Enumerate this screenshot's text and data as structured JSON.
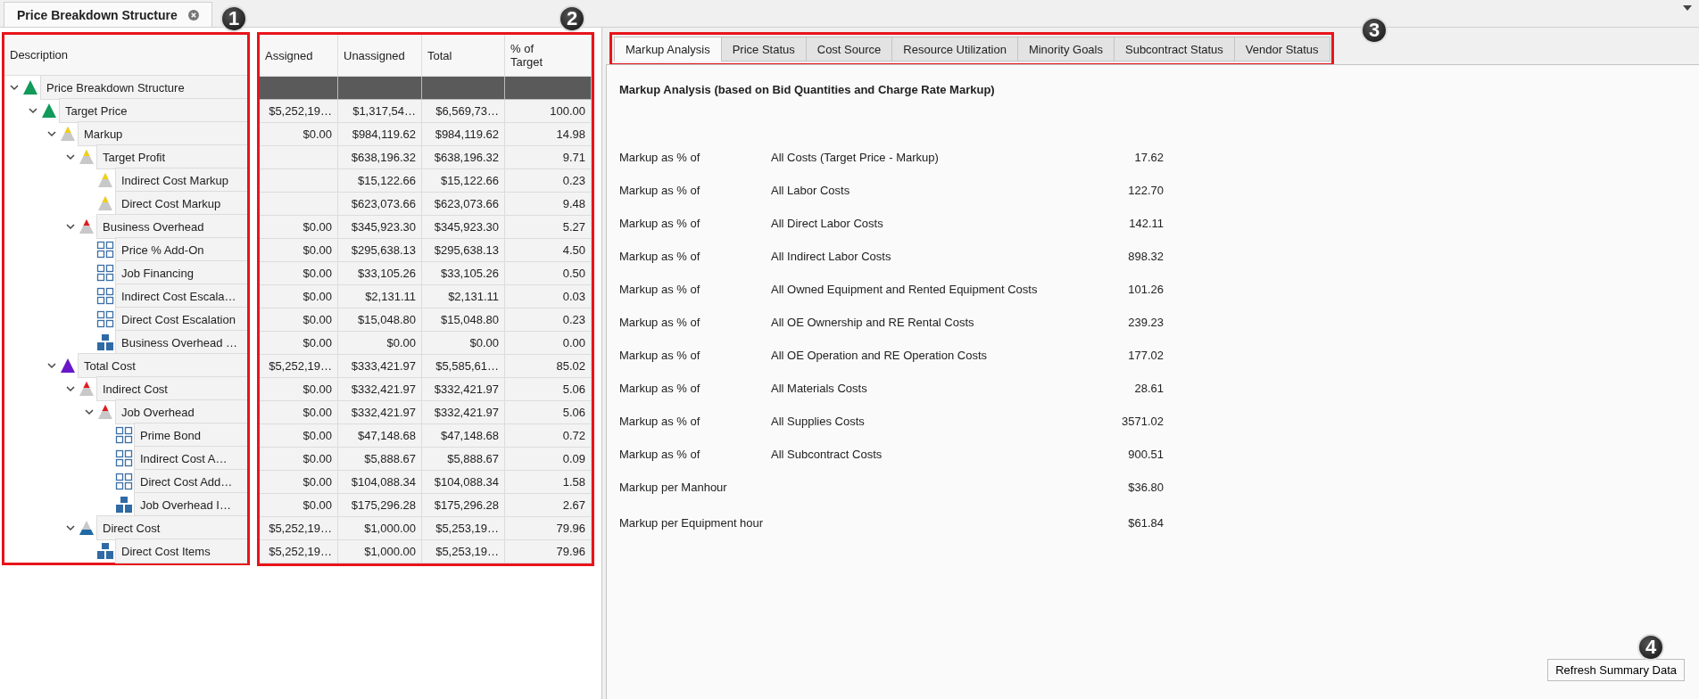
{
  "document_tab": {
    "title": "Price Breakdown Structure"
  },
  "tree": {
    "columns": [
      "Description",
      "Assigned",
      "Unassigned",
      "Total",
      "% of Target"
    ],
    "rows": [
      {
        "label": "Price Breakdown Structure",
        "kind": "target",
        "expanded": true,
        "children": [
          {
            "label": "Target Price",
            "kind": "target",
            "expanded": true,
            "cells": [
              "$5,252,19…",
              "$1,317,54…",
              "$6,569,73…",
              "100.00"
            ],
            "children": [
              {
                "label": "Markup",
                "kind": "markup",
                "expanded": true,
                "cells": [
                  "$0.00",
                  "$984,119.62",
                  "$984,119.62",
                  "14.98"
                ],
                "children": [
                  {
                    "label": "Target Profit",
                    "kind": "markup",
                    "expanded": true,
                    "cells": [
                      "",
                      "$638,196.32",
                      "$638,196.32",
                      "9.71"
                    ],
                    "children": [
                      {
                        "label": "Indirect Cost Markup",
                        "kind": "markup",
                        "cells": [
                          "",
                          "$15,122.66",
                          "$15,122.66",
                          "0.23"
                        ]
                      },
                      {
                        "label": "Direct Cost Markup",
                        "kind": "markup",
                        "cells": [
                          "",
                          "$623,073.66",
                          "$623,073.66",
                          "9.48"
                        ]
                      }
                    ]
                  },
                  {
                    "label": "Business Overhead",
                    "kind": "overhead",
                    "expanded": true,
                    "cells": [
                      "$0.00",
                      "$345,923.30",
                      "$345,923.30",
                      "5.27"
                    ],
                    "children": [
                      {
                        "label": "Price % Add-On",
                        "kind": "addon",
                        "cells": [
                          "$0.00",
                          "$295,638.13",
                          "$295,638.13",
                          "4.50"
                        ]
                      },
                      {
                        "label": "Job Financing",
                        "kind": "addon",
                        "cells": [
                          "$0.00",
                          "$33,105.26",
                          "$33,105.26",
                          "0.50"
                        ]
                      },
                      {
                        "label": "Indirect Cost Escala…",
                        "kind": "addon",
                        "cells": [
                          "$0.00",
                          "$2,131.11",
                          "$2,131.11",
                          "0.03"
                        ]
                      },
                      {
                        "label": "Direct Cost Escalation",
                        "kind": "addon",
                        "cells": [
                          "$0.00",
                          "$15,048.80",
                          "$15,048.80",
                          "0.23"
                        ]
                      },
                      {
                        "label": "Business Overhead …",
                        "kind": "items",
                        "cells": [
                          "$0.00",
                          "$0.00",
                          "$0.00",
                          "0.00"
                        ]
                      }
                    ]
                  }
                ]
              },
              {
                "label": "Total Cost",
                "kind": "total",
                "expanded": true,
                "cells": [
                  "$5,252,19…",
                  "$333,421.97",
                  "$5,585,61…",
                  "85.02"
                ],
                "children": [
                  {
                    "label": "Indirect Cost",
                    "kind": "overhead",
                    "expanded": true,
                    "cells": [
                      "$0.00",
                      "$332,421.97",
                      "$332,421.97",
                      "5.06"
                    ],
                    "children": [
                      {
                        "label": "Job Overhead",
                        "kind": "overhead",
                        "expanded": true,
                        "cells": [
                          "$0.00",
                          "$332,421.97",
                          "$332,421.97",
                          "5.06"
                        ],
                        "children": [
                          {
                            "label": "Prime Bond",
                            "kind": "addon",
                            "cells": [
                              "$0.00",
                              "$47,148.68",
                              "$47,148.68",
                              "0.72"
                            ]
                          },
                          {
                            "label": "Indirect Cost A…",
                            "kind": "addon",
                            "cells": [
                              "$0.00",
                              "$5,888.67",
                              "$5,888.67",
                              "0.09"
                            ]
                          },
                          {
                            "label": "Direct Cost Add…",
                            "kind": "addon",
                            "cells": [
                              "$0.00",
                              "$104,088.34",
                              "$104,088.34",
                              "1.58"
                            ]
                          },
                          {
                            "label": "Job Overhead I…",
                            "kind": "items",
                            "cells": [
                              "$0.00",
                              "$175,296.28",
                              "$175,296.28",
                              "2.67"
                            ]
                          }
                        ]
                      }
                    ]
                  },
                  {
                    "label": "Direct Cost",
                    "kind": "direct",
                    "expanded": true,
                    "cells": [
                      "$5,252,19…",
                      "$1,000.00",
                      "$5,253,19…",
                      "79.96"
                    ],
                    "children": [
                      {
                        "label": "Direct Cost Items",
                        "kind": "items",
                        "cells": [
                          "$5,252,19…",
                          "$1,000.00",
                          "$5,253,19…",
                          "79.96"
                        ]
                      }
                    ]
                  }
                ]
              }
            ]
          }
        ]
      }
    ]
  },
  "summary": {
    "tabs": [
      {
        "label": "Markup Analysis",
        "selected": true
      },
      {
        "label": "Price Status",
        "selected": false
      },
      {
        "label": "Cost Source",
        "selected": false
      },
      {
        "label": "Resource Utilization",
        "selected": false
      },
      {
        "label": "Minority Goals",
        "selected": false
      },
      {
        "label": "Subcontract Status",
        "selected": false
      },
      {
        "label": "Vendor Status",
        "selected": false
      }
    ],
    "heading": "Markup Analysis (based on Bid Quantities and Charge Rate Markup)",
    "rows": [
      {
        "label": "Markup as % of",
        "basis": "All Costs (Target Price - Markup)",
        "value": "17.62"
      },
      {
        "label": "Markup as % of",
        "basis": "All Labor Costs",
        "value": "122.70"
      },
      {
        "label": "Markup as % of",
        "basis": "All Direct Labor Costs",
        "value": "142.11"
      },
      {
        "label": "Markup as % of",
        "basis": "All Indirect Labor Costs",
        "value": "898.32"
      },
      {
        "label": "Markup as % of",
        "basis": "All Owned Equipment and Rented Equipment Costs",
        "value": "101.26"
      },
      {
        "label": "Markup as % of",
        "basis": "All OE Ownership and RE Rental Costs",
        "value": "239.23"
      },
      {
        "label": "Markup as % of",
        "basis": "All OE Operation and RE Operation Costs",
        "value": "177.02"
      },
      {
        "label": "Markup as % of",
        "basis": "All Materials Costs",
        "value": "28.61"
      },
      {
        "label": "Markup as % of",
        "basis": "All Supplies Costs",
        "value": "3571.02"
      },
      {
        "label": "Markup as % of",
        "basis": "All Subcontract Costs",
        "value": "900.51"
      },
      {
        "label": "Markup per Manhour",
        "value": "$36.80"
      },
      {
        "label": "Markup per Equipment hour",
        "value": "$61.84"
      }
    ],
    "refresh_button": "Refresh Summary Data"
  },
  "callouts": [
    "1",
    "2",
    "3",
    "4"
  ]
}
